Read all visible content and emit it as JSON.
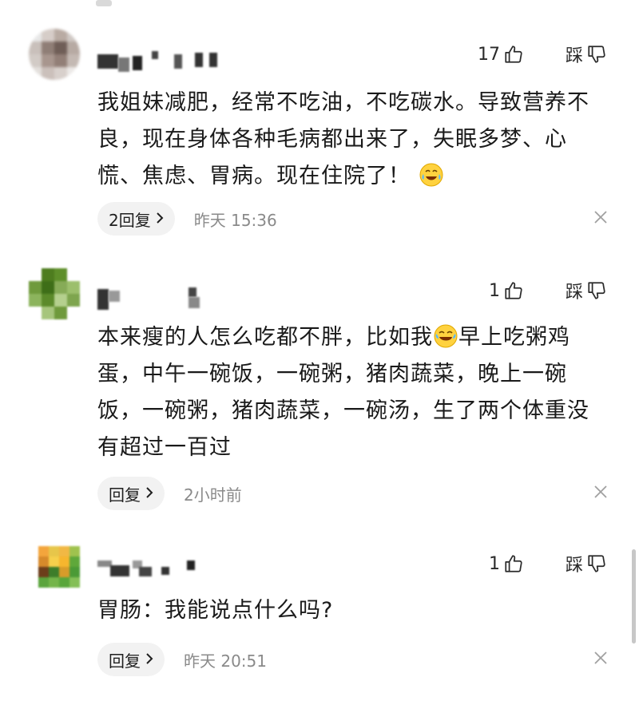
{
  "comments": [
    {
      "like_count": "17",
      "dislike_label": "踩",
      "text": "我姐妹减肥，经常不吃油，不吃碳水。导致营养不良，现在身体各种毛病都出来了，失眠多梦、心慌、焦虑、胃病。现在住院了！",
      "emoji": "cry-laugh-emoji",
      "reply_label": "2回复",
      "time": "昨天 15:36"
    },
    {
      "like_count": "1",
      "dislike_label": "踩",
      "text_before_emoji": "本来瘦的人怎么吃都不胖，比如我",
      "emoji": "tears-of-joy-emoji",
      "text_after_emoji": "早上吃粥鸡蛋，中午一碗饭，一碗粥，猪肉蔬菜，晚上一碗饭，一碗粥，猪肉蔬菜，一碗汤，生了两个体重没有超过一百过",
      "reply_label": "回复",
      "time": "2小时前"
    },
    {
      "like_count": "1",
      "dislike_label": "踩",
      "text": "胃肠：我能说点什么吗?",
      "reply_label": "回复",
      "time": "昨天 20:51"
    }
  ],
  "colors": {
    "text": "#1a1a1a",
    "muted": "#8a8a8a",
    "reply_bg": "#f2f2f2"
  },
  "icons": {
    "like": "thumbs-up-icon",
    "dislike": "thumbs-down-icon",
    "close": "close-icon",
    "chevron": "chevron-right-icon"
  }
}
